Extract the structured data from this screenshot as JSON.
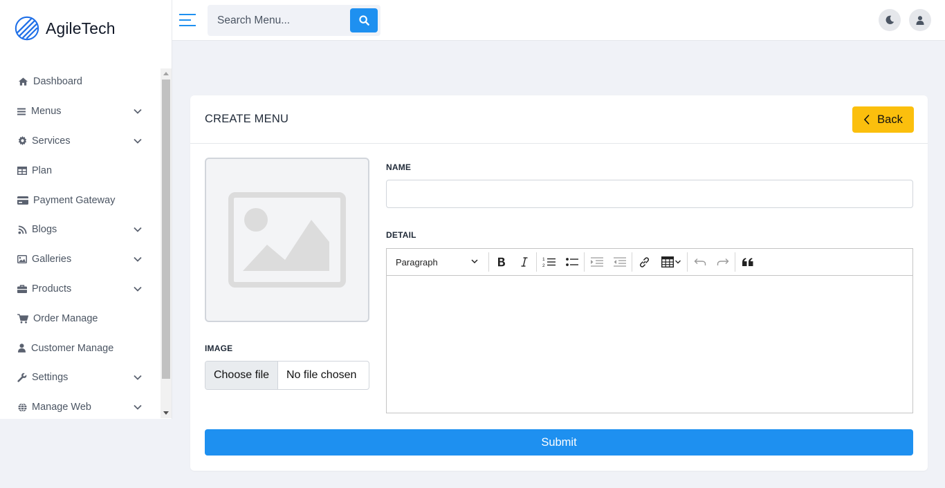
{
  "brand": {
    "name": "AgileTech"
  },
  "search": {
    "placeholder": "Search Menu..."
  },
  "sidebar": {
    "items": [
      {
        "label": "Dashboard",
        "icon": "home-icon",
        "has_submenu": false
      },
      {
        "label": "Menus",
        "icon": "list-icon",
        "has_submenu": true
      },
      {
        "label": "Services",
        "icon": "gear-icon",
        "has_submenu": true
      },
      {
        "label": "Plan",
        "icon": "table-icon",
        "has_submenu": false
      },
      {
        "label": "Payment Gateway",
        "icon": "credit-card-icon",
        "has_submenu": false
      },
      {
        "label": "Blogs",
        "icon": "blog-icon",
        "has_submenu": true
      },
      {
        "label": "Galleries",
        "icon": "image-icon",
        "has_submenu": true
      },
      {
        "label": "Products",
        "icon": "briefcase-icon",
        "has_submenu": true
      },
      {
        "label": "Order Manage",
        "icon": "cart-icon",
        "has_submenu": false
      },
      {
        "label": "Customer Manage",
        "icon": "user-icon",
        "has_submenu": false
      },
      {
        "label": "Settings",
        "icon": "wrench-icon",
        "has_submenu": true
      },
      {
        "label": "Manage Web",
        "icon": "globe-icon",
        "has_submenu": true
      }
    ]
  },
  "card": {
    "title": "CREATE MENU",
    "back_label": "Back",
    "image_label": "IMAGE",
    "choose_file_label": "Choose file",
    "no_file_label": "No file chosen",
    "name_label": "NAME",
    "name_value": "",
    "detail_label": "DETAIL",
    "paragraph_label": "Paragraph",
    "submit_label": "Submit"
  },
  "colors": {
    "primary": "#1e90f0",
    "warning": "#fbbf0d",
    "page_bg": "#f0f2f7"
  }
}
